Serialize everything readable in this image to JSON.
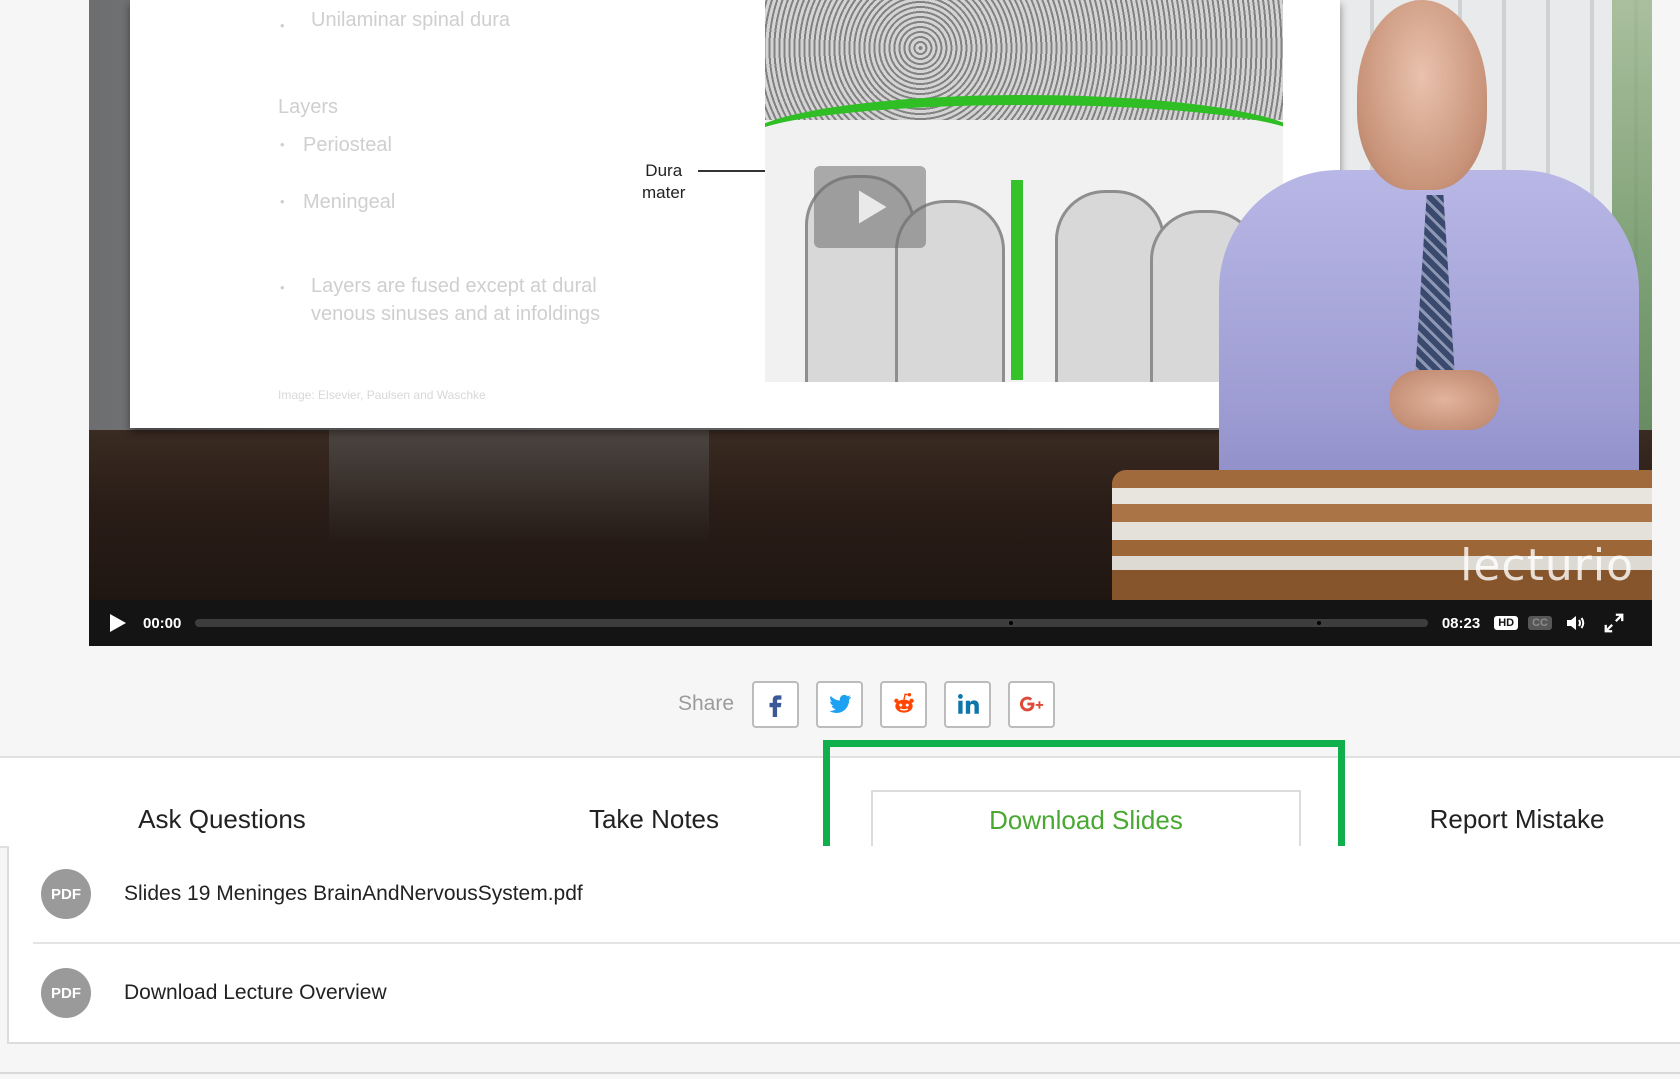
{
  "slide": {
    "bullet_top": "Unilaminar spinal dura",
    "layers_heading": "Layers",
    "layer_items": [
      "Periosteal",
      "Meningeal"
    ],
    "note_line1": "Layers are fused except at dural",
    "note_line2": "venous sinuses and at infoldings",
    "credit": "Image: Elsevier, Paulsen and Waschke",
    "figure_label_line1": "Dura",
    "figure_label_line2": "mater"
  },
  "video": {
    "watermark": "lecturio",
    "current_time": "00:00",
    "duration": "08:23",
    "progress": 0.0,
    "chapter_markers": [
      0.66,
      0.91
    ],
    "hd_label": "HD",
    "cc_label": "CC",
    "icons": {
      "play": "play-icon",
      "volume": "volume-icon",
      "fullscreen": "fullscreen-icon",
      "big_play": "play-icon"
    }
  },
  "share": {
    "label": "Share",
    "networks": [
      {
        "name": "facebook",
        "glyph": "f",
        "color": "#3b5998"
      },
      {
        "name": "twitter",
        "glyph": "twitter",
        "color": "#1da1f2"
      },
      {
        "name": "reddit",
        "glyph": "reddit",
        "color": "#ff4500"
      },
      {
        "name": "linkedin",
        "glyph": "in",
        "color": "#0e76a8"
      },
      {
        "name": "google-plus",
        "glyph": "G+",
        "color": "#dd4b39"
      }
    ]
  },
  "tabs": [
    {
      "label": "Ask Questions",
      "active": false
    },
    {
      "label": "Take Notes",
      "active": false
    },
    {
      "label": "Download Slides",
      "active": true
    },
    {
      "label": "Report Mistake",
      "active": false
    }
  ],
  "downloads": [
    {
      "icon_label": "PDF",
      "name": "Slides 19 Meninges BrainAndNervousSystem.pdf"
    },
    {
      "icon_label": "PDF",
      "name": "Download Lecture Overview"
    }
  ],
  "colors": {
    "accent_green": "#49a832",
    "highlight_green": "#0fb04b",
    "control_bar": "#141414"
  }
}
